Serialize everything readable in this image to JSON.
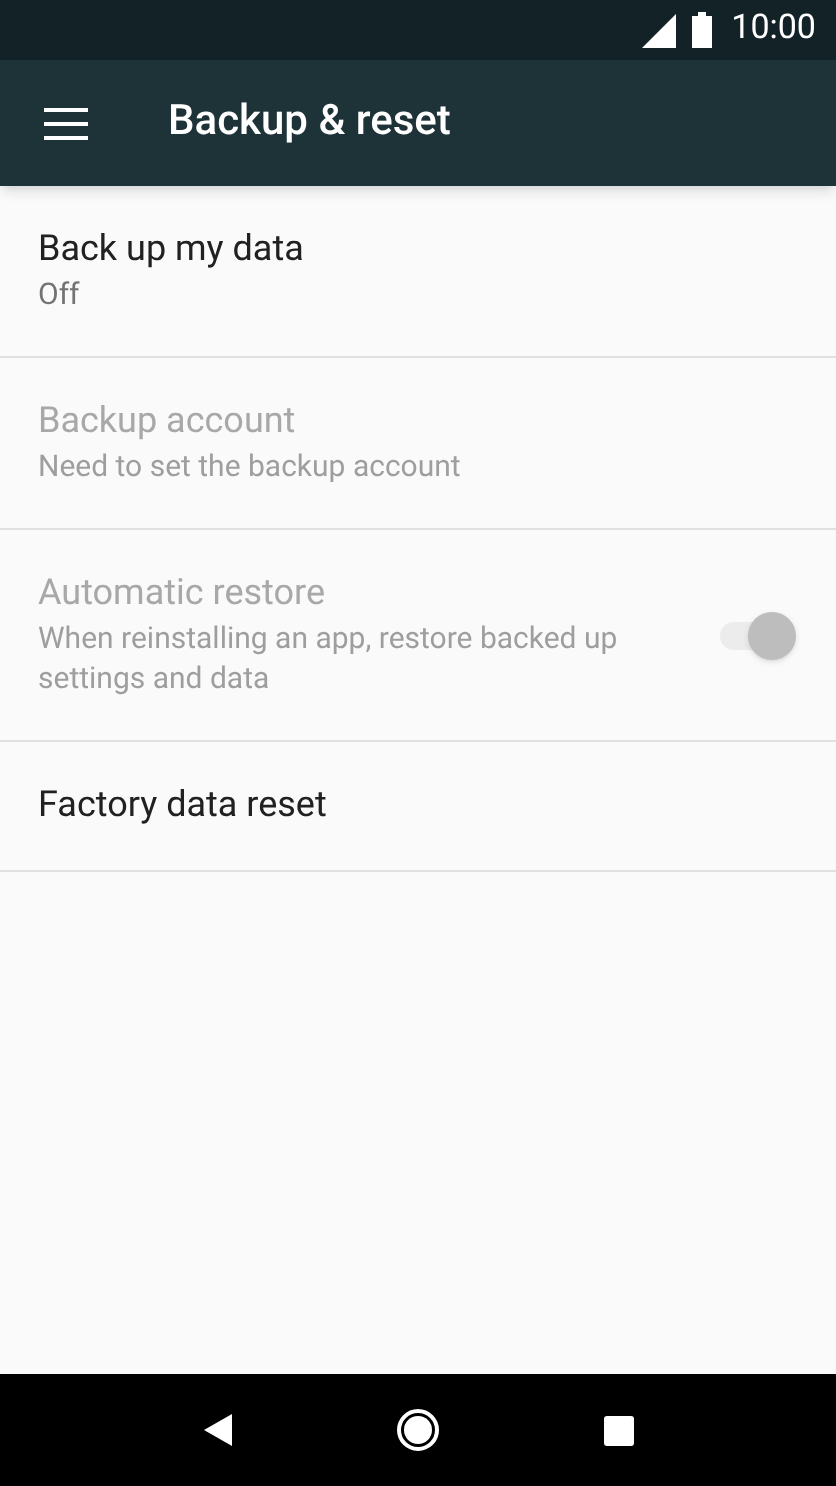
{
  "status_bar": {
    "time": "10:00"
  },
  "toolbar": {
    "title": "Backup & reset"
  },
  "settings": [
    {
      "kind": "text",
      "title": "Back up my data",
      "summary": "Off",
      "disabled": false
    },
    {
      "kind": "text",
      "title": "Backup account",
      "summary": "Need to set the backup account",
      "disabled": true
    },
    {
      "kind": "switch",
      "title": "Automatic restore",
      "summary": "When reinstalling an app, restore backed up settings and data",
      "disabled": true,
      "on": true
    },
    {
      "kind": "text",
      "title": "Factory data reset",
      "disabled": false
    }
  ]
}
